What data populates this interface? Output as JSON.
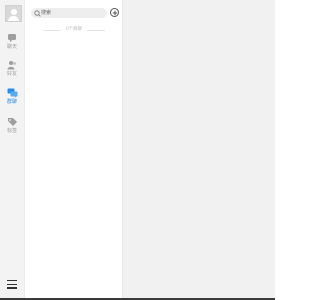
{
  "sidebar": {
    "avatar": "avatar-icon",
    "items": [
      {
        "label": "聊天",
        "icon": "chat-icon",
        "active": false
      },
      {
        "label": "好友",
        "icon": "friends-icon",
        "active": false
      },
      {
        "label": "群聊",
        "icon": "group-chat-icon",
        "active": true
      },
      {
        "label": "标签",
        "icon": "tag-icon",
        "active": false
      }
    ],
    "menu_icon": "hamburger-menu-icon"
  },
  "search": {
    "placeholder": "搜索",
    "icon": "search-icon"
  },
  "add_button": {
    "icon": "plus-icon"
  },
  "list": {
    "divider_text": "0个群聊"
  },
  "colors": {
    "accent": "#2a8ce8",
    "rail_bg": "#f3f3f3",
    "content_bg": "#f1f1f1"
  }
}
